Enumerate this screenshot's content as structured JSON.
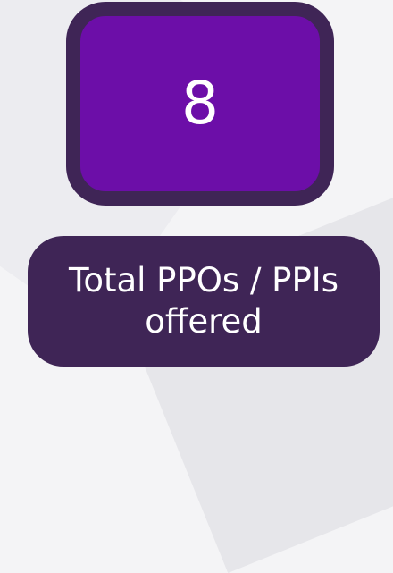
{
  "stat": {
    "value": "8",
    "label": "Total PPOs / PPIs\noffered"
  },
  "colors": {
    "tile_fill": "#6c0ea8",
    "tile_border": "#3f2556",
    "label_fill": "#3f2556",
    "text": "#ffffff",
    "background": "#f4f4f6"
  }
}
